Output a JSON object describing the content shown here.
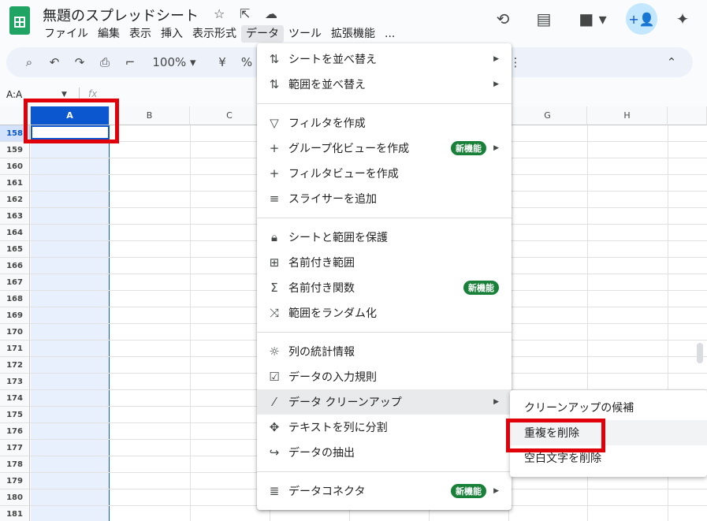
{
  "doc": {
    "title": "無題のスプレッドシート"
  },
  "menubar": [
    "ファイル",
    "編集",
    "表示",
    "挿入",
    "表示形式",
    "データ",
    "ツール",
    "拡張機能",
    "..."
  ],
  "toolbar": {
    "zoom": "100%",
    "currency": "¥",
    "percent": "%"
  },
  "namebox": "A:A",
  "fx": "fx",
  "columns": [
    "A",
    "B",
    "C",
    "G",
    "H"
  ],
  "rows": [
    "158",
    "159",
    "160",
    "161",
    "162",
    "163",
    "164",
    "165",
    "166",
    "167",
    "168",
    "169",
    "170",
    "171",
    "172",
    "173",
    "174",
    "175",
    "176",
    "177",
    "178",
    "179",
    "180",
    "181"
  ],
  "data_menu": {
    "items": [
      {
        "icon": "sort-icon",
        "label": "シートを並べ替え",
        "submenu": true
      },
      {
        "icon": "sort-icon",
        "label": "範囲を並べ替え",
        "submenu": true
      },
      {
        "icon": "filter-icon",
        "label": "フィルタを作成"
      },
      {
        "icon": "plus-icon",
        "label": "グループ化ビューを作成",
        "badge": "新機能",
        "submenu": true
      },
      {
        "icon": "plus-icon",
        "label": "フィルタビューを作成"
      },
      {
        "icon": "slicer-icon",
        "label": "スライサーを追加"
      },
      {
        "icon": "lock-icon",
        "label": "シートと範囲を保護"
      },
      {
        "icon": "named-range-icon",
        "label": "名前付き範囲"
      },
      {
        "icon": "sigma-icon",
        "label": "名前付き関数",
        "badge": "新機能"
      },
      {
        "icon": "shuffle-icon",
        "label": "範囲をランダム化"
      },
      {
        "icon": "lightbulb-icon",
        "label": "列の統計情報"
      },
      {
        "icon": "validation-icon",
        "label": "データの入力規則"
      },
      {
        "icon": "magic-wand-icon",
        "label": "データ クリーンアップ",
        "submenu": true
      },
      {
        "icon": "split-icon",
        "label": "テキストを列に分割"
      },
      {
        "icon": "extract-icon",
        "label": "データの抽出"
      },
      {
        "icon": "database-icon",
        "label": "データコネクタ",
        "badge": "新機能",
        "submenu": true
      }
    ]
  },
  "cleanup_submenu": [
    "クリーンアップの候補",
    "重複を削除",
    "空白文字を削除"
  ]
}
